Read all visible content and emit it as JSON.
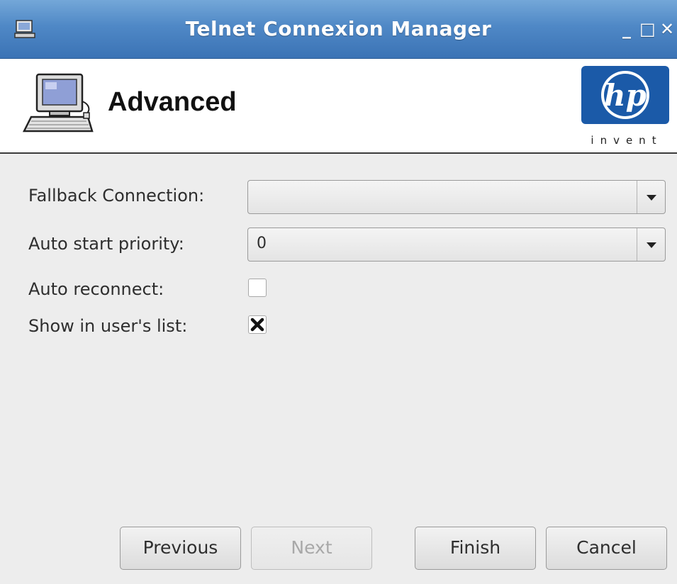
{
  "window": {
    "title": "Telnet Connexion Manager",
    "controls": {
      "minimize": "_",
      "maximize": "□",
      "close": "✕"
    }
  },
  "header": {
    "title": "Advanced",
    "logo_text": "invent"
  },
  "form": {
    "fallback_label": "Fallback Connection:",
    "fallback_value": "",
    "priority_label": "Auto start priority:",
    "priority_value": "0",
    "reconnect_label": "Auto reconnect:",
    "reconnect_checked": false,
    "show_list_label": "Show in user's list:",
    "show_list_checked": true
  },
  "buttons": {
    "previous": "Previous",
    "next": "Next",
    "finish": "Finish",
    "cancel": "Cancel"
  },
  "colors": {
    "titlebar": "#4f88c6",
    "hp_blue": "#1b5aa8"
  }
}
